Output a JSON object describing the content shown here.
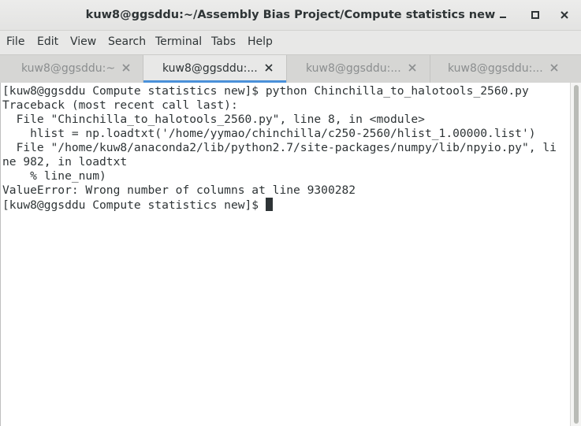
{
  "window": {
    "title": "kuw8@ggsddu:~/Assembly Bias Project/Compute statistics new"
  },
  "menubar": {
    "items": [
      "File",
      "Edit",
      "View",
      "Search",
      "Terminal",
      "Tabs",
      "Help"
    ]
  },
  "tabs": [
    {
      "label": "kuw8@ggsddu:~",
      "active": false
    },
    {
      "label": "kuw8@ggsddu:...",
      "active": true
    },
    {
      "label": "kuw8@ggsddu:...",
      "active": false
    },
    {
      "label": "kuw8@ggsddu:...",
      "active": false
    }
  ],
  "terminal": {
    "lines": [
      "[kuw8@ggsddu Compute statistics new]$ python Chinchilla_to_halotools_2560.py",
      "Traceback (most recent call last):",
      "  File \"Chinchilla_to_halotools_2560.py\", line 8, in <module>",
      "    hlist = np.loadtxt('/home/yymao/chinchilla/c250-2560/hlist_1.00000.list')",
      "  File \"/home/kuw8/anaconda2/lib/python2.7/site-packages/numpy/lib/npyio.py\", li",
      "ne 982, in loadtxt",
      "    % line_num)",
      "ValueError: Wrong number of columns at line 9300282"
    ],
    "prompt": "[kuw8@ggsddu Compute statistics new]$ "
  },
  "colors": {
    "accent": "#4a90d9",
    "text": "#2e3436",
    "inactive_tab_text": "#8b8e8f"
  }
}
